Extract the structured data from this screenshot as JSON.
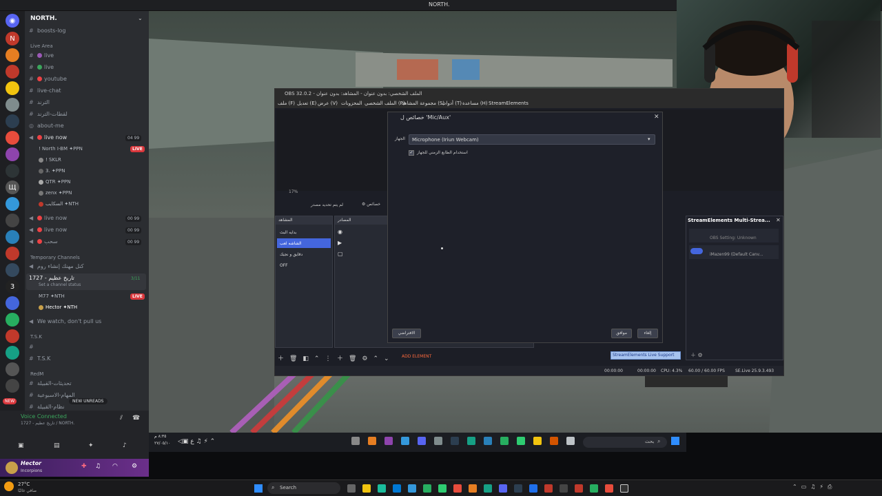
{
  "window_title": "NORTH.",
  "discord": {
    "server_name": "NORTH.",
    "channels_top": [
      {
        "name": "boosts-log"
      }
    ],
    "live_area_label": "Live Area",
    "live_channels": [
      {
        "name": "live",
        "dot": "#9b59b6"
      },
      {
        "name": "live",
        "dot": "#3ba55c"
      },
      {
        "name": "youtube",
        "dot": "#ed4245"
      },
      {
        "name": "live-chat"
      },
      {
        "name": "الترند"
      },
      {
        "name": "لقطات-الترند"
      }
    ],
    "about": "about-me",
    "voice_channels": [
      {
        "name": "live now",
        "count": "04 99"
      },
      {
        "name": "live now",
        "count": "00 99"
      },
      {
        "name": "live now",
        "count": "00 99"
      },
      {
        "name": "سحب",
        "count": "00 99"
      }
    ],
    "voice_users": [
      {
        "name": "! North I-BM",
        "tag": "PPN",
        "live": "LIVE"
      },
      {
        "name": "! SKLR"
      },
      {
        "name": "3.",
        "tag": "PPN"
      },
      {
        "name": "QTR",
        "tag": "PPN"
      },
      {
        "name": "zenx",
        "tag": "PPN"
      },
      {
        "name": "السكايب",
        "tag": "NTH"
      }
    ],
    "temp_label": "Temporary Channels",
    "temp_channels": [
      {
        "name": "كنل مهنك إنشاء روم"
      },
      {
        "name": "1727 - تاريخ عظيم",
        "sub": "Set a channel status",
        "count": "3/11"
      }
    ],
    "temp_users": [
      {
        "name": "M77",
        "tag": "NTH",
        "live": "LIVE"
      },
      {
        "name": "Hector",
        "tag": "NTH"
      }
    ],
    "watch_channel": "We watch, don't pull us",
    "tsk_label": "T.S.K",
    "tsk_channels": [
      "",
      "T.S.K"
    ],
    "redm_label": "RedM",
    "redm_channels": [
      "تحديثات-القبيلة",
      "المهام-الاسبوعية",
      "نظام-القبيلة"
    ],
    "new_unreads": "NEW UNREADS",
    "new_badge": "NEW",
    "voice_connected": "Voice Connected",
    "voice_sub": "1727 - تاريخ عظيم / NORTH.",
    "user_name": "Hector",
    "user_status": "Incorpions"
  },
  "obs": {
    "title": "OBS 32.0.2 - الملف الشخصي: بدون عنوان - المشاهد: بدون عنوان",
    "menu": [
      "ملف (F)",
      "تعديل (E)",
      "عرض (V)",
      "المحزونات",
      "الملف الشخصي (P)",
      "مجموعة المشاهد (S)",
      "أدوات (T)",
      "مساعدة (H)",
      "StreamElements"
    ],
    "zoom": "17%",
    "status_no_source": "لم يتم تحديد مصدر",
    "properties_btn": "خصائص",
    "scenes_header": "المشاهد",
    "sources_header": "المصادر",
    "scenes": [
      "بدايه البث",
      "الشاشه لعب",
      "دقايق و نجيك",
      "OFF"
    ],
    "add_element": "ADD ELEMENT",
    "se_panel_title": "StreamElements Multi-Strea...",
    "se_items": [
      {
        "name": "OBS Setting: Unknown"
      },
      {
        "name": "iMazen99 (Default Canv..."
      }
    ],
    "se_tooltip": "StreamElements Live Support",
    "status": {
      "rec_time": "00:00:00",
      "stream_time": "00:00:00",
      "cpu": "CPU: 4.3%",
      "fps": "60.00 / 60.00 FPS",
      "version": "SE.Live 25.9.3.493"
    }
  },
  "dialog": {
    "title": "خصائص ل 'Mic/Aux'",
    "device_label": "الجهاز",
    "device_value": "Microphone (Iriun Webcam)",
    "checkbox_label": "استخدام الطابع الزمني للجهاز",
    "checkbox_checked": true,
    "defaults_btn": "الافتراضي",
    "ok_btn": "موافق",
    "cancel_btn": "إلغاء"
  },
  "game_taskbar": {
    "search_placeholder": "بحث",
    "time": "٨:٣٥ م",
    "date": "٢٧/٠٥/١٠"
  },
  "taskbar": {
    "weather_temp": "27°C",
    "weather_desc": "صافي غالبًا",
    "search": "Search"
  },
  "colors": {
    "accent": "#4466dd",
    "live_red": "#da373c",
    "discord_bg": "#2b2d31",
    "obs_bg": "#1c1e26"
  }
}
